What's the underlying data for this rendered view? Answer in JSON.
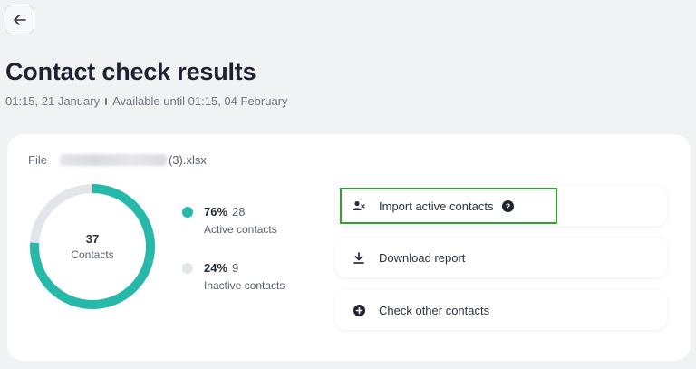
{
  "page": {
    "title": "Contact check results",
    "created": "01:15, 21 January",
    "available": "Available until 01:15, 04 February"
  },
  "file": {
    "label": "File",
    "name_suffix": "(3).xlsx"
  },
  "summary": {
    "total": "37",
    "total_label": "Contacts",
    "active_fraction": 0.76
  },
  "legend": [
    {
      "pct": "76%",
      "count": "28",
      "label": "Active contacts",
      "color": "#26b8a8"
    },
    {
      "pct": "24%",
      "count": "9",
      "label": "Inactive contacts",
      "color": "#e2e5ea"
    }
  ],
  "actions": {
    "import": {
      "label": "Import active contacts",
      "icon": "user-import-icon"
    },
    "download": {
      "label": "Download report",
      "icon": "download-icon"
    },
    "check": {
      "label": "Check other contacts",
      "icon": "plus-circle-icon"
    }
  },
  "colors": {
    "accent": "#26b8a8",
    "track": "#e2e5ea",
    "highlight": "#2fa12f"
  }
}
